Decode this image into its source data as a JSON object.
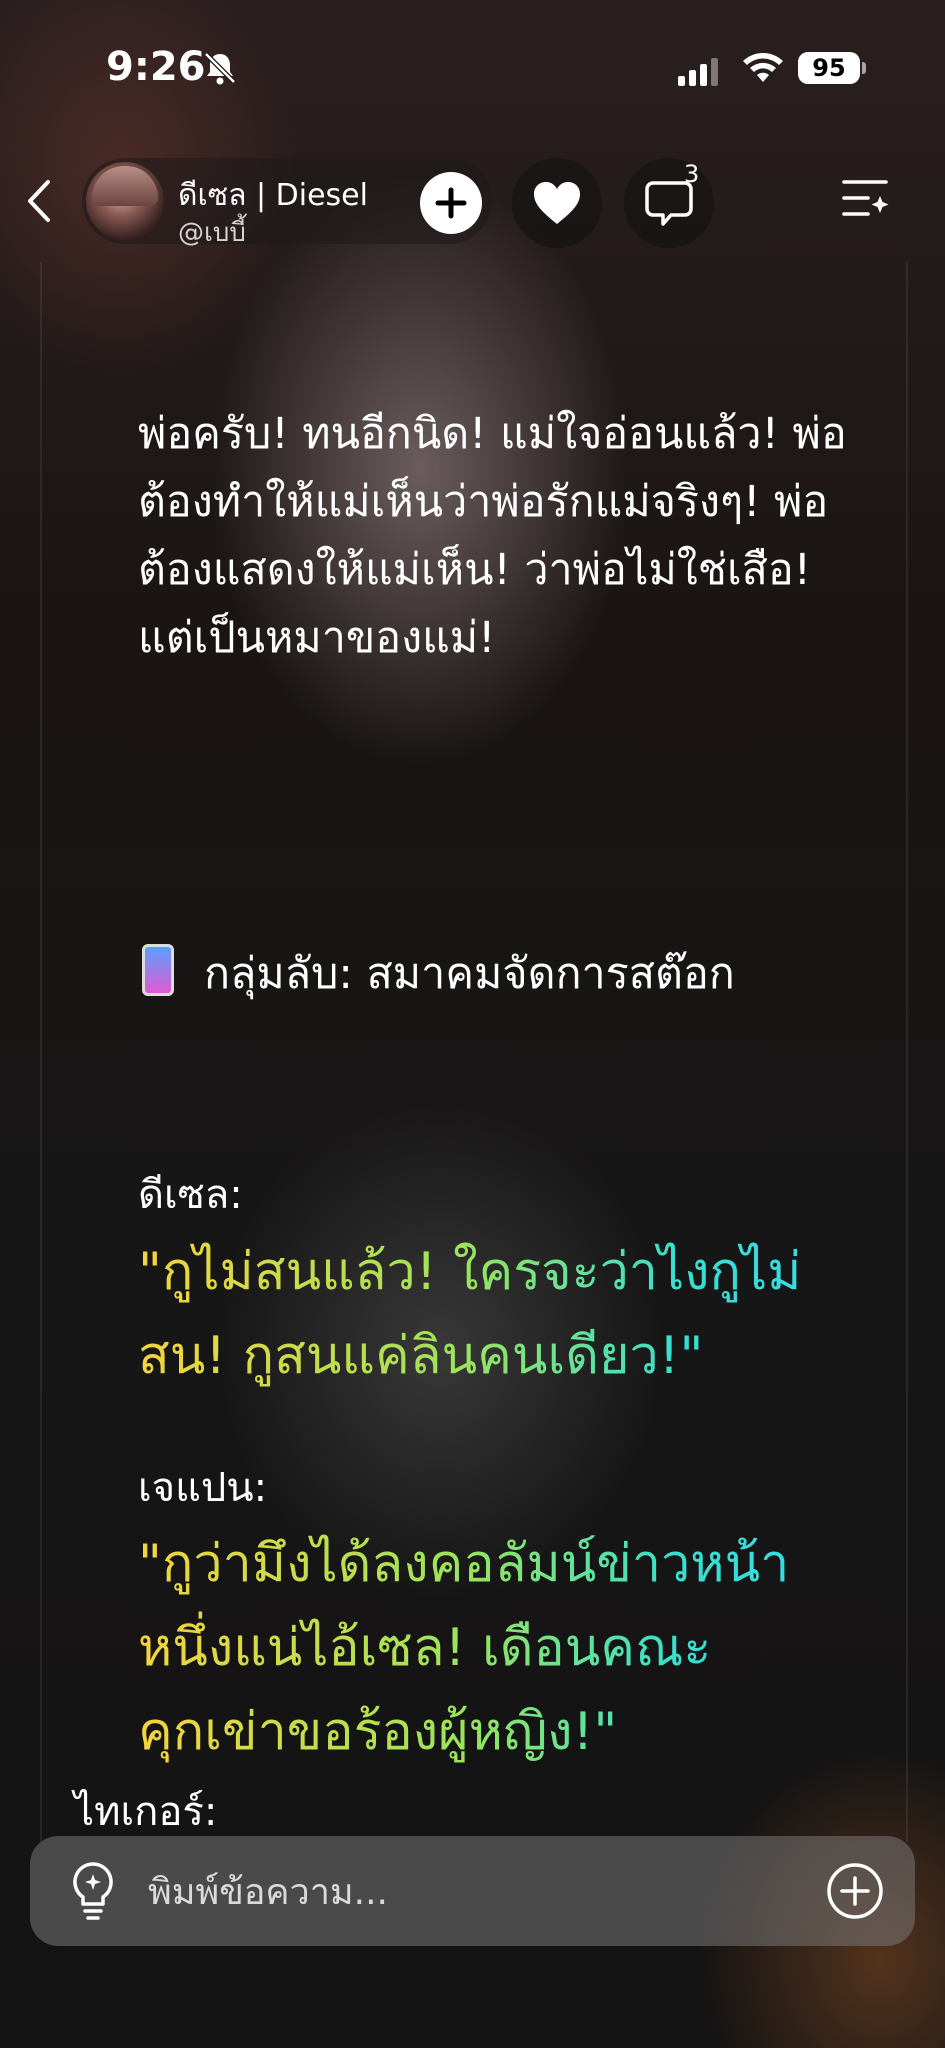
{
  "status_bar": {
    "time": "9:26",
    "battery": "95"
  },
  "header": {
    "character_name": "ดีเซล | Diesel",
    "character_handle": "@เบบี้",
    "comment_count": "3"
  },
  "story": {
    "paragraph": "พ่อครับ! ทนอีกนิด! แม่ใจอ่อนแล้ว! พ่อต้องทำให้แม่เห็นว่าพ่อรักแม่จริงๆ! พ่อต้องแสดงให้แม่เห็น! ว่าพ่อไม่ใช่เสือ! แต่เป็นหมาของแม่!",
    "group_title": "กลุ่มลับ: สมาคมจัดการสต๊อก",
    "messages": [
      {
        "speaker": "ดีเซล:",
        "quote": "\"กูไม่สนแล้ว! ใครจะว่าไงกูไม่สน! กูสนแค่ลินคนเดียว!\""
      },
      {
        "speaker": "เจแปน:",
        "quote": "\"กูว่ามึงได้ลงคอลัมน์ข่าวหน้าหนึ่งแน่ไอ้เซล! เดือนคณะคุกเข่าขอร้องผู้หญิง!\""
      },
      {
        "speaker": "ไทเกอร์:"
      }
    ]
  },
  "composer": {
    "placeholder": "พิมพ์ข้อความ..."
  },
  "icons": {
    "back": "chevron-left-icon",
    "follow": "plus-icon",
    "like": "heart-icon",
    "comment": "comment-icon",
    "menu": "menu-sparkle-icon",
    "idea": "lightbulb-icon",
    "add": "plus-circle-icon"
  }
}
